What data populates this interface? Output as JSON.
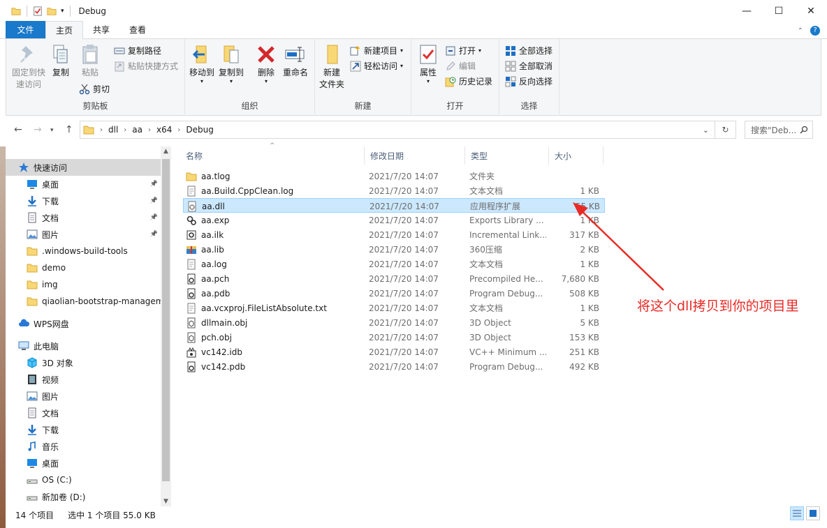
{
  "window": {
    "title": "Debug",
    "controls": {
      "minimize": "—",
      "maximize": "☐",
      "close": "✕"
    }
  },
  "ribbon_tabs": [
    {
      "label": "文件"
    },
    {
      "label": "主页"
    },
    {
      "label": "共享"
    },
    {
      "label": "查看"
    }
  ],
  "ribbon": {
    "clipboard": {
      "label": "剪贴板",
      "pin_quick_access": "固定到快\n速访问",
      "pin_line1": "固定到快",
      "pin_line2": "速访问",
      "copy": "复制",
      "paste": "粘贴",
      "copy_path": "复制路径",
      "paste_shortcut": "粘贴快捷方式",
      "cut": "剪切"
    },
    "organize": {
      "label": "组织",
      "move_to": "移动到",
      "copy_to": "复制到",
      "delete": "删除",
      "rename": "重命名"
    },
    "new": {
      "label": "新建",
      "new_folder_line1": "新建",
      "new_folder_line2": "文件夹",
      "new_item": "新建项目",
      "easy_access": "轻松访问"
    },
    "open": {
      "label": "打开",
      "properties": "属性",
      "open": "打开",
      "edit": "编辑",
      "history": "历史记录"
    },
    "select": {
      "label": "选择",
      "select_all": "全部选择",
      "select_none": "全部取消",
      "invert": "反向选择"
    }
  },
  "address": {
    "crumbs": [
      "dll",
      "aa",
      "x64",
      "Debug"
    ],
    "search_placeholder": "搜索\"Deb...",
    "back": "←",
    "forward": "→",
    "up": "↑",
    "recent": "⌄",
    "refresh": "↻"
  },
  "nav": {
    "items": [
      {
        "label": "快速访问",
        "icon": "star-icon"
      },
      {
        "label": "桌面",
        "icon": "desktop-icon",
        "pinned": true
      },
      {
        "label": "下载",
        "icon": "download-icon",
        "pinned": true
      },
      {
        "label": "文档",
        "icon": "document-icon",
        "pinned": true
      },
      {
        "label": "图片",
        "icon": "picture-icon",
        "pinned": true
      },
      {
        "label": ".windows-build-tools",
        "icon": "folder-icon"
      },
      {
        "label": "demo",
        "icon": "folder-icon"
      },
      {
        "label": "img",
        "icon": "folder-icon"
      },
      {
        "label": "qiaolian-bootstrap-managem",
        "icon": "folder-icon"
      },
      {
        "label": "WPS网盘",
        "icon": "cloud-icon"
      },
      {
        "label": "此电脑",
        "icon": "pc-icon"
      },
      {
        "label": "3D 对象",
        "icon": "3d-icon"
      },
      {
        "label": "视频",
        "icon": "video-icon"
      },
      {
        "label": "图片",
        "icon": "picture-icon"
      },
      {
        "label": "文档",
        "icon": "document-icon"
      },
      {
        "label": "下载",
        "icon": "download-icon"
      },
      {
        "label": "音乐",
        "icon": "music-icon"
      },
      {
        "label": "桌面",
        "icon": "desktop-icon"
      },
      {
        "label": "OS (C:)",
        "icon": "drive-icon"
      },
      {
        "label": "新加卷 (D:)",
        "icon": "drive-icon"
      }
    ]
  },
  "columns": {
    "name": "名称",
    "date": "修改日期",
    "type": "类型",
    "size": "大小"
  },
  "files": [
    {
      "name": "aa.tlog",
      "date": "2021/7/20 14:07",
      "type": "文件夹",
      "size": "",
      "icon": "folder-icon"
    },
    {
      "name": "aa.Build.CppClean.log",
      "date": "2021/7/20 14:07",
      "type": "文本文档",
      "size": "1 KB",
      "icon": "text-file-icon"
    },
    {
      "name": "aa.dll",
      "date": "2021/7/20 14:07",
      "type": "应用程序扩展",
      "size": "55 KB",
      "icon": "dll-icon",
      "selected": true
    },
    {
      "name": "aa.exp",
      "date": "2021/7/20 14:07",
      "type": "Exports Library ...",
      "size": "1 KB",
      "icon": "exp-icon"
    },
    {
      "name": "aa.ilk",
      "date": "2021/7/20 14:07",
      "type": "Incremental Link...",
      "size": "317 KB",
      "icon": "ilk-icon"
    },
    {
      "name": "aa.lib",
      "date": "2021/7/20 14:07",
      "type": "360压缩",
      "size": "2 KB",
      "icon": "archive-icon"
    },
    {
      "name": "aa.log",
      "date": "2021/7/20 14:07",
      "type": "文本文档",
      "size": "1 KB",
      "icon": "text-file-icon"
    },
    {
      "name": "aa.pch",
      "date": "2021/7/20 14:07",
      "type": "Precompiled He...",
      "size": "7,680 KB",
      "icon": "pch-icon"
    },
    {
      "name": "aa.pdb",
      "date": "2021/7/20 14:07",
      "type": "Program Debug...",
      "size": "508 KB",
      "icon": "pdb-icon"
    },
    {
      "name": "aa.vcxproj.FileListAbsolute.txt",
      "date": "2021/7/20 14:07",
      "type": "文本文档",
      "size": "1 KB",
      "icon": "text-file-icon"
    },
    {
      "name": "dllmain.obj",
      "date": "2021/7/20 14:07",
      "type": "3D Object",
      "size": "5 KB",
      "icon": "obj-icon"
    },
    {
      "name": "pch.obj",
      "date": "2021/7/20 14:07",
      "type": "3D Object",
      "size": "153 KB",
      "icon": "obj-icon"
    },
    {
      "name": "vc142.idb",
      "date": "2021/7/20 14:07",
      "type": "VC++ Minimum ...",
      "size": "251 KB",
      "icon": "idb-icon"
    },
    {
      "name": "vc142.pdb",
      "date": "2021/7/20 14:07",
      "type": "Program Debug...",
      "size": "492 KB",
      "icon": "pdb-icon"
    }
  ],
  "status": {
    "count": "14 个项目",
    "selection": "选中 1 个项目  55.0 KB"
  },
  "annotation": {
    "text": "将这个dll拷贝到你的项目里",
    "color": "#e82a25"
  },
  "colors": {
    "accent": "#1979ca",
    "selection_bg": "#cce8ff",
    "selection_border": "#99d1ff"
  }
}
